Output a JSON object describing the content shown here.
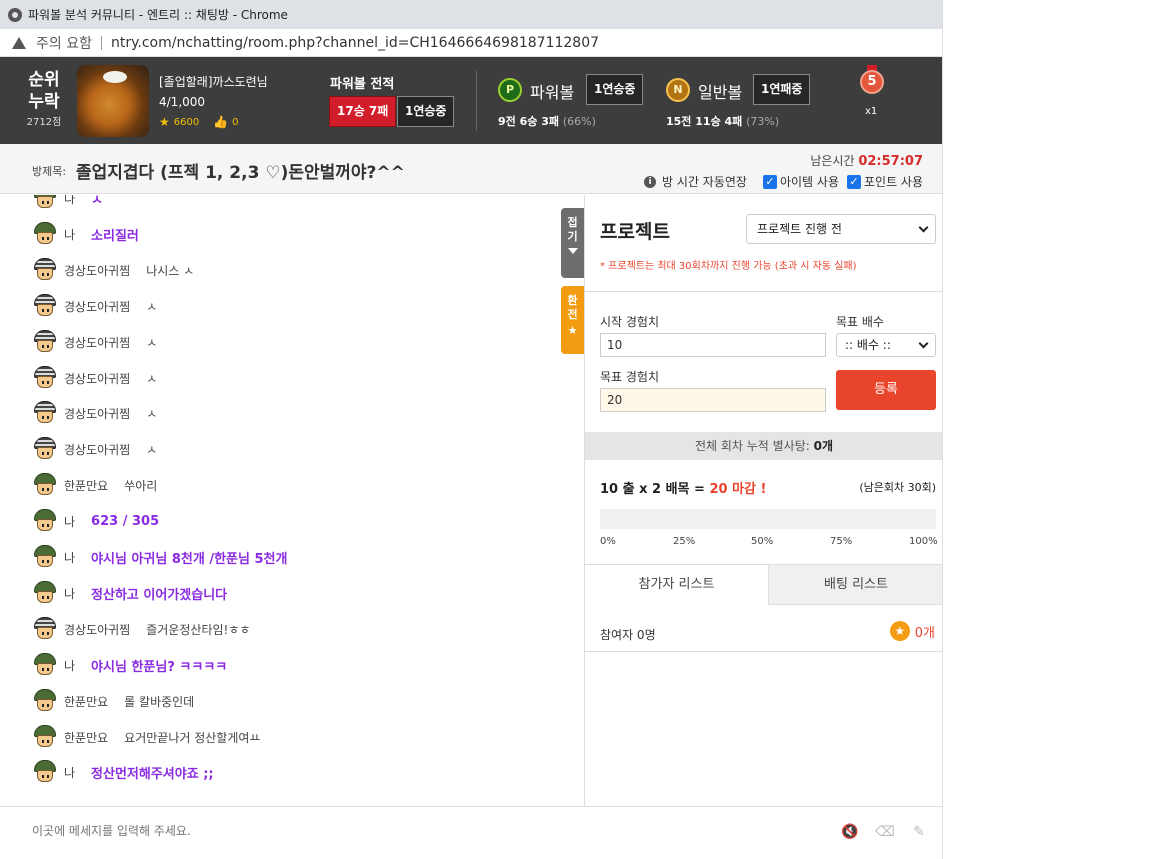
{
  "browser": {
    "title": "파워볼 분석 커뮤니티 - 엔트리 :: 채팅방 - Chrome",
    "security": "주의 요함",
    "url": "ntry.com/nchatting/room.php?channel_id=CH1646664698187112807"
  },
  "profile": {
    "rank_line1": "순위",
    "rank_line2": "누락",
    "points": "2712점",
    "username": "[졸업할래]까스도련님",
    "level": "4/1,000",
    "stars": "6600",
    "likes": "0"
  },
  "record": {
    "title": "파워볼 전적",
    "win_loss": "17승 7패",
    "streak": "1연승중"
  },
  "powerball": {
    "ball": "P",
    "label": "파워볼",
    "streak": "1연승중",
    "summary": "9전 6승 3패",
    "pct": "(66%)"
  },
  "normalball": {
    "ball": "N",
    "label": "일반볼",
    "streak": "1연패중",
    "summary": "15전 11승 4패",
    "pct": "(73%)"
  },
  "medal": {
    "number": "5",
    "count": "x1"
  },
  "room": {
    "label": "방제목:",
    "title": "졸업지겹다 (프젝 1, 2,3 ♡)돈안벌꺼야?^^",
    "remain_label": "남은시간",
    "remain_time": "02:57:07",
    "auto_extend": "방 시간 자동연장",
    "item_use": "아이템 사용",
    "point_use": "포인트 사용"
  },
  "chat": {
    "messages": [
      {
        "nick": "나",
        "text": "ㅅ",
        "me": true
      },
      {
        "nick": "나",
        "text": "소리질러",
        "me": true
      },
      {
        "nick": "경상도아귀찜",
        "text": "나시스 ㅅ",
        "me": false
      },
      {
        "nick": "경상도아귀찜",
        "text": "ㅅ",
        "me": false
      },
      {
        "nick": "경상도아귀찜",
        "text": "ㅅ",
        "me": false
      },
      {
        "nick": "경상도아귀찜",
        "text": "ㅅ",
        "me": false
      },
      {
        "nick": "경상도아귀찜",
        "text": "ㅅ",
        "me": false
      },
      {
        "nick": "경상도아귀찜",
        "text": "ㅅ",
        "me": false
      },
      {
        "nick": "한푼만요",
        "text": "쑤아리",
        "me": false
      },
      {
        "nick": "나",
        "text": "623 / 305",
        "me": true
      },
      {
        "nick": "나",
        "text": "야시님 아귀님 8천개 /한푼님 5천개",
        "me": true
      },
      {
        "nick": "나",
        "text": "정산하고 이어가겠습니다",
        "me": true
      },
      {
        "nick": "경상도아귀찜",
        "text": "즐거운정산타임!ㅎㅎ",
        "me": false
      },
      {
        "nick": "나",
        "text": "야시님 한푼님? ㅋㅋㅋㅋ",
        "me": true
      },
      {
        "nick": "한푼만요",
        "text": "롤 칼바중인데",
        "me": false
      },
      {
        "nick": "한푼만요",
        "text": "요거만끝나거 정산할게여ㅛ",
        "me": false
      },
      {
        "nick": "나",
        "text": "정산먼저해주셔야죠 ;;",
        "me": true
      }
    ],
    "fold_tab": "접기",
    "exchange_tab": "환전",
    "input_placeholder": "이곳에 메세지를 입력해 주세요."
  },
  "project": {
    "title": "프로젝트",
    "status_select": "프로젝트 진행 전",
    "note": "* 프로젝트는 최대 30회차까지 진행 가능 (초과 시 자동 실패)",
    "start_exp_label": "시작 경험치",
    "start_exp_value": "10",
    "target_mult_label": "목표 배수",
    "target_mult_select": ":: 배수 ::",
    "target_exp_label": "목표 경험치",
    "target_exp_value": "20",
    "register_button": "등록",
    "total_label": "전체 회차 누적 별사탕:",
    "total_value": "0개",
    "formula_start": "10 출",
    "formula_mult": "x 2 배목",
    "formula_eq": "=",
    "formula_end": "20 마감 !",
    "remain_rounds": "(남은회차 30회)",
    "progress": 0,
    "ticks": [
      "0%",
      "25%",
      "50%",
      "75%",
      "100%"
    ],
    "tab_participants": "참가자 리스트",
    "tab_betting": "배팅 리스트",
    "participant_count": "참여자 0명",
    "star_total": "0개"
  },
  "colors": {
    "accent_red": "#e8452c",
    "my_message": "#8a2be2",
    "topbar_bg": "#3d3d3d"
  }
}
